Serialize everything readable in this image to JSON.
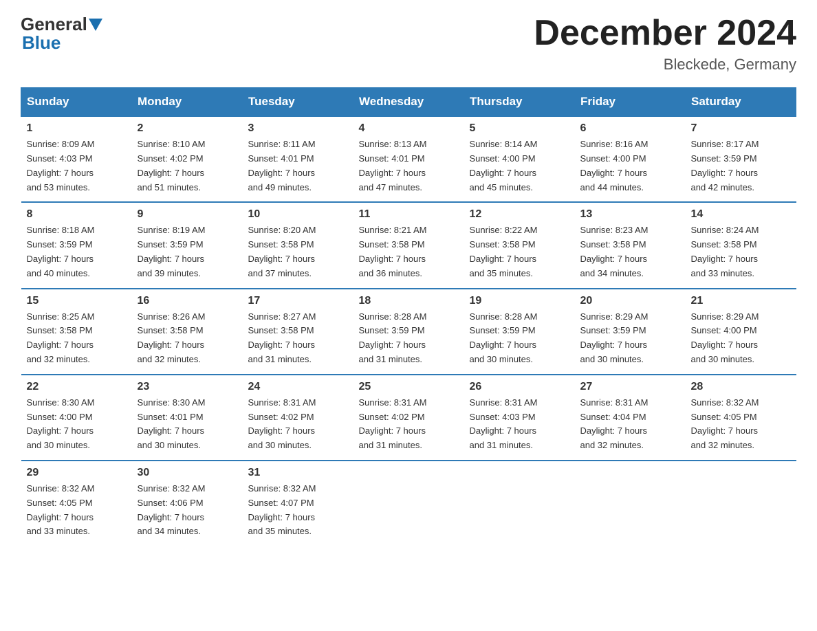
{
  "header": {
    "logo_line1": "General",
    "logo_line2": "Blue",
    "title": "December 2024",
    "subtitle": "Bleckede, Germany"
  },
  "weekdays": [
    "Sunday",
    "Monday",
    "Tuesday",
    "Wednesday",
    "Thursday",
    "Friday",
    "Saturday"
  ],
  "weeks": [
    [
      {
        "day": "1",
        "sunrise": "8:09 AM",
        "sunset": "4:03 PM",
        "daylight": "7 hours and 53 minutes."
      },
      {
        "day": "2",
        "sunrise": "8:10 AM",
        "sunset": "4:02 PM",
        "daylight": "7 hours and 51 minutes."
      },
      {
        "day": "3",
        "sunrise": "8:11 AM",
        "sunset": "4:01 PM",
        "daylight": "7 hours and 49 minutes."
      },
      {
        "day": "4",
        "sunrise": "8:13 AM",
        "sunset": "4:01 PM",
        "daylight": "7 hours and 47 minutes."
      },
      {
        "day": "5",
        "sunrise": "8:14 AM",
        "sunset": "4:00 PM",
        "daylight": "7 hours and 45 minutes."
      },
      {
        "day": "6",
        "sunrise": "8:16 AM",
        "sunset": "4:00 PM",
        "daylight": "7 hours and 44 minutes."
      },
      {
        "day": "7",
        "sunrise": "8:17 AM",
        "sunset": "3:59 PM",
        "daylight": "7 hours and 42 minutes."
      }
    ],
    [
      {
        "day": "8",
        "sunrise": "8:18 AM",
        "sunset": "3:59 PM",
        "daylight": "7 hours and 40 minutes."
      },
      {
        "day": "9",
        "sunrise": "8:19 AM",
        "sunset": "3:59 PM",
        "daylight": "7 hours and 39 minutes."
      },
      {
        "day": "10",
        "sunrise": "8:20 AM",
        "sunset": "3:58 PM",
        "daylight": "7 hours and 37 minutes."
      },
      {
        "day": "11",
        "sunrise": "8:21 AM",
        "sunset": "3:58 PM",
        "daylight": "7 hours and 36 minutes."
      },
      {
        "day": "12",
        "sunrise": "8:22 AM",
        "sunset": "3:58 PM",
        "daylight": "7 hours and 35 minutes."
      },
      {
        "day": "13",
        "sunrise": "8:23 AM",
        "sunset": "3:58 PM",
        "daylight": "7 hours and 34 minutes."
      },
      {
        "day": "14",
        "sunrise": "8:24 AM",
        "sunset": "3:58 PM",
        "daylight": "7 hours and 33 minutes."
      }
    ],
    [
      {
        "day": "15",
        "sunrise": "8:25 AM",
        "sunset": "3:58 PM",
        "daylight": "7 hours and 32 minutes."
      },
      {
        "day": "16",
        "sunrise": "8:26 AM",
        "sunset": "3:58 PM",
        "daylight": "7 hours and 32 minutes."
      },
      {
        "day": "17",
        "sunrise": "8:27 AM",
        "sunset": "3:58 PM",
        "daylight": "7 hours and 31 minutes."
      },
      {
        "day": "18",
        "sunrise": "8:28 AM",
        "sunset": "3:59 PM",
        "daylight": "7 hours and 31 minutes."
      },
      {
        "day": "19",
        "sunrise": "8:28 AM",
        "sunset": "3:59 PM",
        "daylight": "7 hours and 30 minutes."
      },
      {
        "day": "20",
        "sunrise": "8:29 AM",
        "sunset": "3:59 PM",
        "daylight": "7 hours and 30 minutes."
      },
      {
        "day": "21",
        "sunrise": "8:29 AM",
        "sunset": "4:00 PM",
        "daylight": "7 hours and 30 minutes."
      }
    ],
    [
      {
        "day": "22",
        "sunrise": "8:30 AM",
        "sunset": "4:00 PM",
        "daylight": "7 hours and 30 minutes."
      },
      {
        "day": "23",
        "sunrise": "8:30 AM",
        "sunset": "4:01 PM",
        "daylight": "7 hours and 30 minutes."
      },
      {
        "day": "24",
        "sunrise": "8:31 AM",
        "sunset": "4:02 PM",
        "daylight": "7 hours and 30 minutes."
      },
      {
        "day": "25",
        "sunrise": "8:31 AM",
        "sunset": "4:02 PM",
        "daylight": "7 hours and 31 minutes."
      },
      {
        "day": "26",
        "sunrise": "8:31 AM",
        "sunset": "4:03 PM",
        "daylight": "7 hours and 31 minutes."
      },
      {
        "day": "27",
        "sunrise": "8:31 AM",
        "sunset": "4:04 PM",
        "daylight": "7 hours and 32 minutes."
      },
      {
        "day": "28",
        "sunrise": "8:32 AM",
        "sunset": "4:05 PM",
        "daylight": "7 hours and 32 minutes."
      }
    ],
    [
      {
        "day": "29",
        "sunrise": "8:32 AM",
        "sunset": "4:05 PM",
        "daylight": "7 hours and 33 minutes."
      },
      {
        "day": "30",
        "sunrise": "8:32 AM",
        "sunset": "4:06 PM",
        "daylight": "7 hours and 34 minutes."
      },
      {
        "day": "31",
        "sunrise": "8:32 AM",
        "sunset": "4:07 PM",
        "daylight": "7 hours and 35 minutes."
      },
      null,
      null,
      null,
      null
    ]
  ],
  "labels": {
    "sunrise": "Sunrise:",
    "sunset": "Sunset:",
    "daylight": "Daylight:"
  }
}
